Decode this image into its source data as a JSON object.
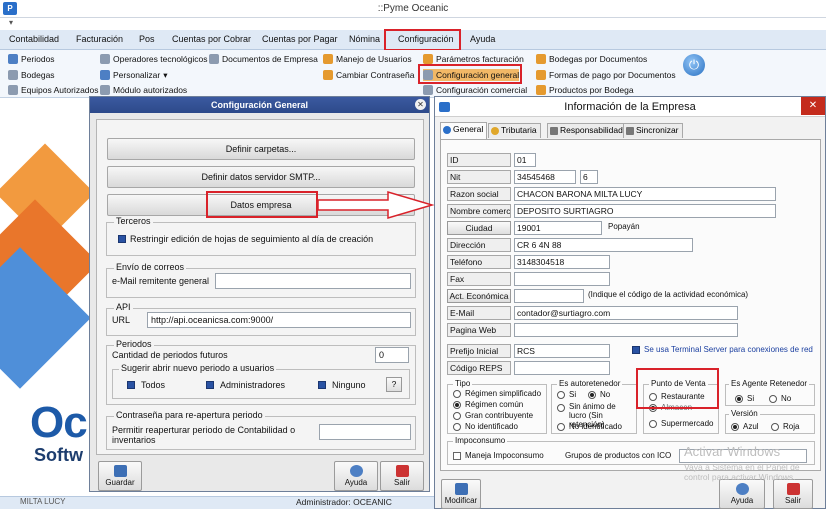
{
  "app": {
    "title": "::Pyme Oceanic",
    "logo": "P"
  },
  "menu": [
    "Contabilidad",
    "Facturación",
    "Pos",
    "Cuentas por Cobrar",
    "Cuentas por Pagar",
    "Nómina",
    "Configuración",
    "Ayuda"
  ],
  "ribbon": {
    "col1": [
      "Periodos",
      "Bodegas",
      "Equipos Autorizados"
    ],
    "col2": [
      "Operadores tecnológicos",
      "Personalizar",
      "Módulo autorizados"
    ],
    "col3": [
      "Documentos de Empresa"
    ],
    "col4": [
      "Manejo de Usuarios",
      "Cambiar Contraseña"
    ],
    "col5": [
      "Parámetros facturación",
      "Configuración general",
      "Configuración comercial"
    ],
    "col6": [
      "Bodegas por Documentos",
      "Formas de pago por Documentos",
      "Productos por Bodega"
    ]
  },
  "background": {
    "brand_big": "Oc",
    "brand_small": "Softw",
    "status_user": "Administrador: OCEANIC",
    "status_left": "MILTA LUCY"
  },
  "config_dialog": {
    "title": "Configuración General",
    "btn_folders": "Definir carpetas...",
    "btn_smtp": "Definir datos servidor SMTP...",
    "btn_company": "Datos empresa",
    "terceros": {
      "title": "Terceros",
      "label": "Restringir edición de hojas de seguimiento al día de creación"
    },
    "email": {
      "title": "Envío de correos",
      "label": "e-Mail remitente general",
      "value": ""
    },
    "api": {
      "title": "API",
      "label": "URL",
      "value": "http://api.oceanicsa.com:9000/"
    },
    "periodos": {
      "title": "Periodos",
      "label": "Cantidad de periodos futuros",
      "value": "0",
      "suggest_title": "Sugerir abrir nuevo periodo a usuarios",
      "options": [
        "Todos",
        "Administradores",
        "Ninguno"
      ],
      "help": "?"
    },
    "password": {
      "title": "Contraseña para re-apertura periodo",
      "label": "Permitir reaperturar periodo de Contabilidad o inventarios",
      "value": ""
    },
    "save": "Guardar",
    "help": "Ayuda",
    "exit": "Salir"
  },
  "company_dialog": {
    "title": "Información de la Empresa",
    "close": "✕",
    "tabs": [
      "General",
      "Tributaria",
      "Responsabilidades",
      "Sincronizar"
    ],
    "fields": {
      "id_label": "ID",
      "id": "01",
      "nit_label": "Nit",
      "nit": "34545468",
      "dv": "6",
      "razon_label": "Razon social",
      "razon": "CHACON BARONA MILTA LUCY",
      "comercial_label": "Nombre comercial",
      "comercial": "DEPOSITO SURTIAGRO",
      "ciudad_label": "Ciudad",
      "ciudad_code": "19001",
      "ciudad_name": "Popayán",
      "direccion_label": "Dirección",
      "direccion": "CR 6 4N 88",
      "telefono_label": "Teléfono",
      "telefono": "3148304518",
      "fax_label": "Fax",
      "fax": "",
      "act_label": "Act. Económica",
      "act": "",
      "act_hint": "(Indique el código de la actividad económica)",
      "email_label": "E-Mail",
      "email": "contador@surtiagro.com",
      "web_label": "Pagina Web",
      "web": "",
      "prefijo_label": "Prefijo Inicial",
      "prefijo": "RCS",
      "reps_label": "Código REPS",
      "reps": "",
      "terminal_label": "Se usa Terminal Server para conexiones de red"
    },
    "tipo": {
      "title": "Tipo",
      "options": [
        "Régimen simplificado",
        "Régimen común",
        "Gran contribuyente",
        "No identificado"
      ],
      "selected": 1
    },
    "autoretenedor": {
      "title": "Es autoretenedor",
      "options": [
        "Si",
        "No",
        "Sin ánimo de lucro (Sin retención)",
        "No identificado"
      ],
      "selected": 1
    },
    "punto_venta": {
      "title": "Punto de Venta",
      "options": [
        "Restaurante",
        "Almacen",
        "Supermercado"
      ],
      "selected": 1
    },
    "agente": {
      "title": "Es Agente Retenedor",
      "options": [
        "Si",
        "No"
      ],
      "selected": 0
    },
    "version": {
      "title": "Versión",
      "options": [
        "Azul",
        "Roja"
      ],
      "selected": 0
    },
    "impoconsumo": {
      "title": "Impoconsumo",
      "checkbox": "Maneja Impoconsumo",
      "grupos": "Grupos de productos con ICO"
    },
    "modify": "Modificar",
    "help": "Ayuda",
    "exit": "Salir",
    "watermark_title": "Activar Windows",
    "watermark_text": "Vaya a Sistema en el Panel de control para activar Windows."
  },
  "colors": {
    "highlight": "#d9222a",
    "title_blue": "#2d4a8a",
    "checkbox_blue": "#2952a3"
  }
}
